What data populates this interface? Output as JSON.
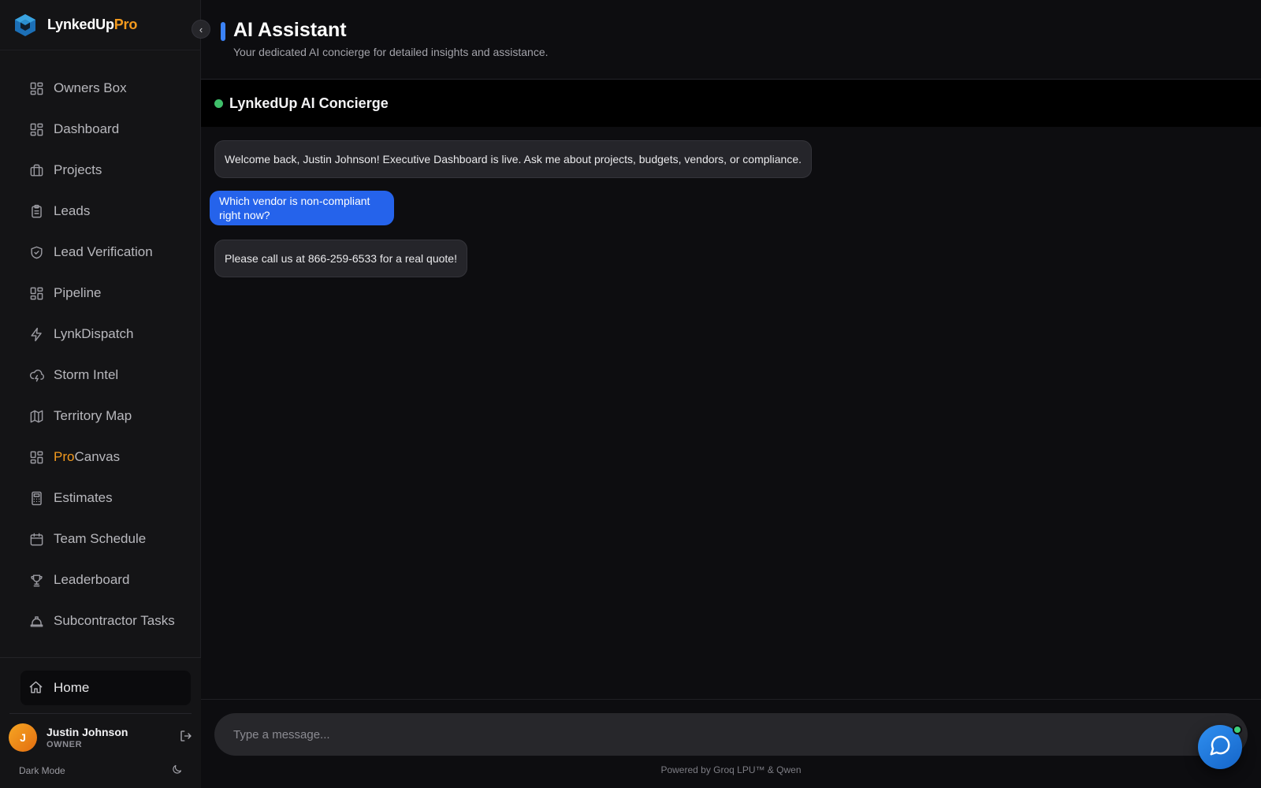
{
  "brand": {
    "name_main": "LynkedUp",
    "name_accent": "Pro"
  },
  "sidebar": {
    "items": [
      {
        "label": "Owners Box",
        "icon": "grid-icon"
      },
      {
        "label": "Dashboard",
        "icon": "grid-icon"
      },
      {
        "label": "Projects",
        "icon": "briefcase-icon"
      },
      {
        "label": "Leads",
        "icon": "clipboard-icon"
      },
      {
        "label": "Lead Verification",
        "icon": "shield-check-icon"
      },
      {
        "label": "Pipeline",
        "icon": "grid-icon"
      },
      {
        "label": "LynkDispatch",
        "icon": "lightning-icon"
      },
      {
        "label": "Storm Intel",
        "icon": "cloud-lightning-icon"
      },
      {
        "label": "Territory Map",
        "icon": "map-icon"
      },
      {
        "label_accent": "Pro",
        "label": "Canvas",
        "icon": "grid-icon"
      },
      {
        "label": "Estimates",
        "icon": "calculator-icon"
      },
      {
        "label": "Team Schedule",
        "icon": "calendar-icon"
      },
      {
        "label": "Leaderboard",
        "icon": "trophy-icon"
      },
      {
        "label": "Subcontractor Tasks",
        "icon": "hard-hat-icon"
      }
    ],
    "home_label": "Home",
    "user": {
      "initial": "J",
      "name": "Justin Johnson",
      "role": "OWNER"
    },
    "dark_mode_label": "Dark Mode"
  },
  "header": {
    "title": "AI Assistant",
    "subtitle": "Your dedicated AI concierge for detailed insights and assistance."
  },
  "chat": {
    "title": "LynkedUp AI Concierge",
    "status_color": "#3fbf6a",
    "messages": [
      {
        "role": "assistant",
        "text": "Welcome back, Justin Johnson! Executive Dashboard is live. Ask me about projects, budgets, vendors, or compliance."
      },
      {
        "role": "user",
        "text": "Which vendor is non-compliant right now?"
      },
      {
        "role": "assistant",
        "text": "Please call us at 866-259-6533 for a real quote!"
      }
    ],
    "input_placeholder": "Type a message...",
    "powered_by": "Powered by Groq LPU™ & Qwen"
  },
  "colors": {
    "accent": "#3b82f6",
    "brand_orange": "#f39a1e",
    "user_bubble": "#2563eb"
  }
}
